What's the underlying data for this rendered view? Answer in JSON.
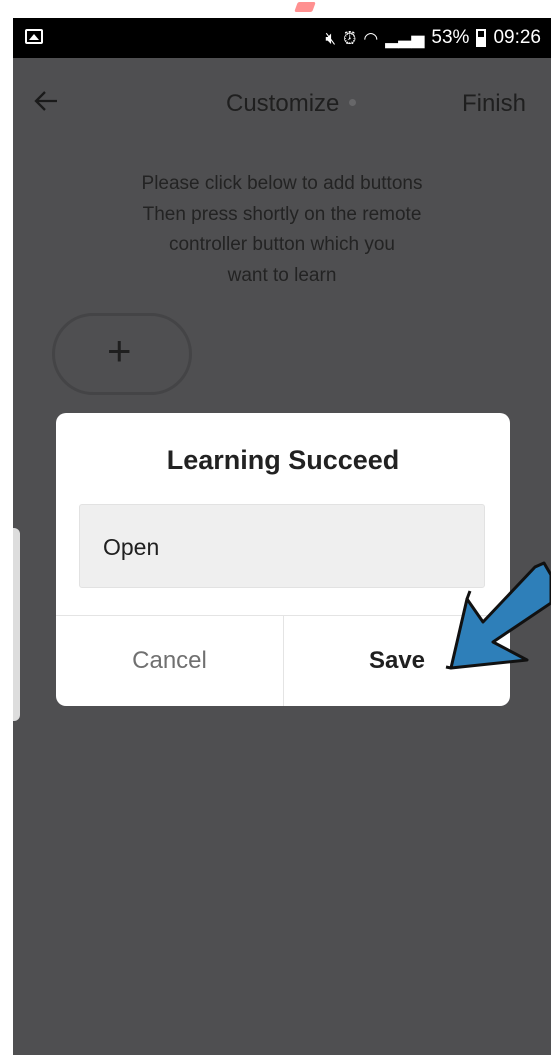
{
  "status_bar": {
    "left_icon": "gallery-notification-icon",
    "icons": [
      "mute-icon",
      "alarm-icon",
      "wifi-icon",
      "signal-icon"
    ],
    "battery": "53%",
    "time": "09:26"
  },
  "header": {
    "back_icon": "arrow-left-icon",
    "title": "Customize",
    "finish_label": "Finish"
  },
  "instructions": [
    "Please click below to add buttons",
    "Then press shortly on the remote",
    "controller button which you",
    "want to learn"
  ],
  "add_button": {
    "icon": "plus-icon",
    "label": "+"
  },
  "dialog": {
    "title": "Learning Succeed",
    "input_value": "Open",
    "cancel_label": "Cancel",
    "save_label": "Save"
  },
  "annotation": {
    "icon": "pointer-arrow-icon",
    "color": "#2e7fb9"
  },
  "colors": {
    "overlay_background": "#4f4f51",
    "dialog_background": "#ffffff",
    "field_background": "#efefef"
  }
}
